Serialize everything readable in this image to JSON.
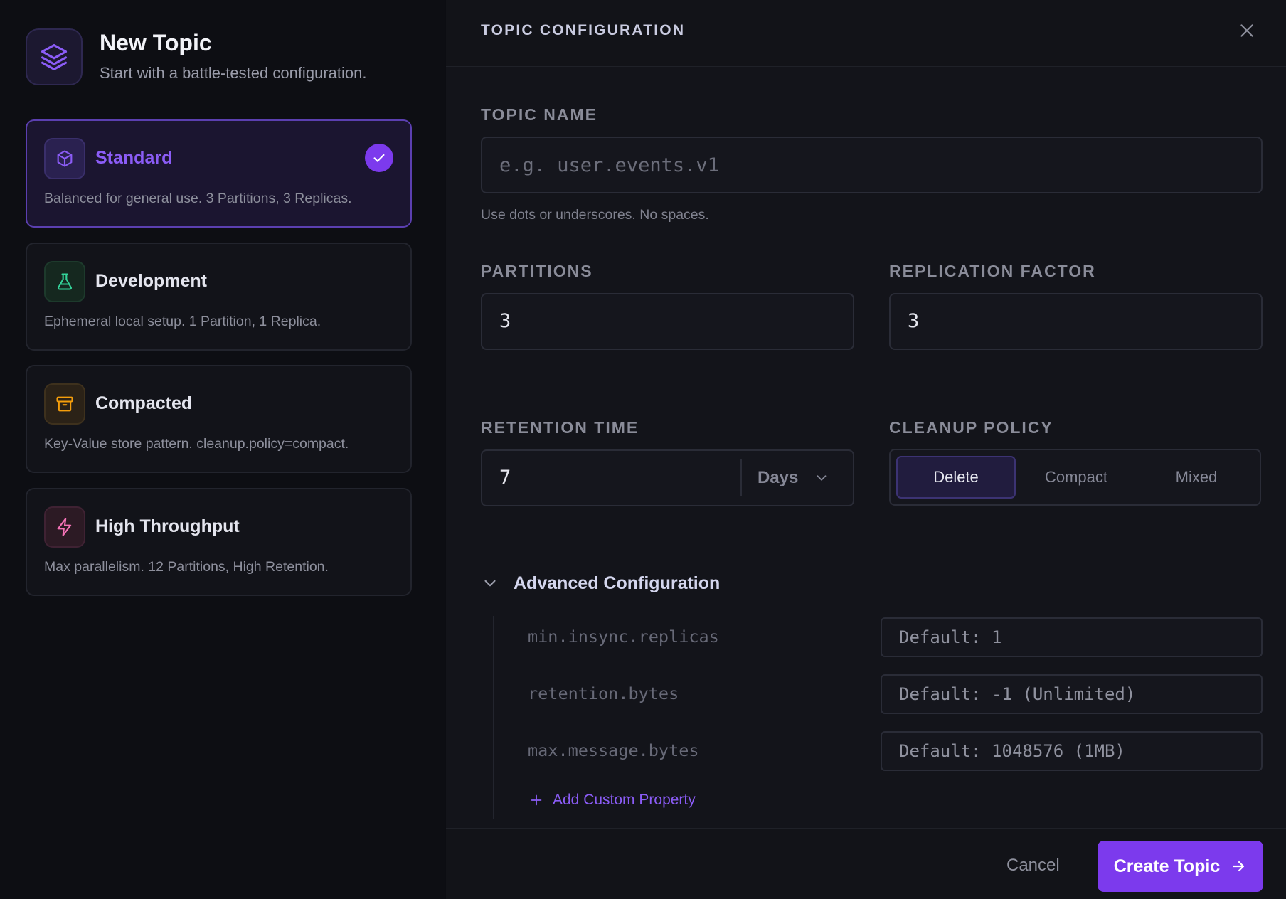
{
  "sidebar": {
    "title": "New Topic",
    "subtitle": "Start with a battle-tested configuration.",
    "presets": [
      {
        "name": "Standard",
        "description": "Balanced for general use. 3 Partitions, 3 Replicas.",
        "icon": "box-icon",
        "selected": true,
        "accent": "#8b5cf6"
      },
      {
        "name": "Development",
        "description": "Ephemeral local setup. 1 Partition, 1 Replica.",
        "icon": "flask-icon",
        "selected": false,
        "accent": "#34d399"
      },
      {
        "name": "Compacted",
        "description": "Key-Value store pattern. cleanup.policy=compact.",
        "icon": "archive-icon",
        "selected": false,
        "accent": "#f59e0b"
      },
      {
        "name": "High Throughput",
        "description": "Max parallelism. 12 Partitions, High Retention.",
        "icon": "lightning-icon",
        "selected": false,
        "accent": "#f472b6"
      }
    ]
  },
  "panel": {
    "title": "TOPIC CONFIGURATION",
    "topic_name": {
      "label": "TOPIC NAME",
      "placeholder": "e.g. user.events.v1",
      "value": "",
      "hint": "Use dots or underscores. No spaces."
    },
    "partitions": {
      "label": "PARTITIONS",
      "value": "3"
    },
    "replication": {
      "label": "REPLICATION FACTOR",
      "value": "3"
    },
    "retention": {
      "label": "RETENTION TIME",
      "value": "7",
      "unit": "Days"
    },
    "cleanup": {
      "label": "CLEANUP POLICY",
      "options": [
        "Delete",
        "Compact",
        "Mixed"
      ],
      "selected": "Delete"
    },
    "advanced": {
      "title": "Advanced Configuration",
      "expanded": true,
      "properties": [
        {
          "key": "min.insync.replicas",
          "placeholder": "Default: 1"
        },
        {
          "key": "retention.bytes",
          "placeholder": "Default: -1 (Unlimited)"
        },
        {
          "key": "max.message.bytes",
          "placeholder": "Default: 1048576 (1MB)"
        }
      ],
      "add_label": "Add Custom Property"
    }
  },
  "footer": {
    "cancel_label": "Cancel",
    "create_label": "Create Topic"
  },
  "colors": {
    "accent": "#7c3aed",
    "accent_light": "#8b5cf6",
    "background": "#0d0e13",
    "panel": "#13141a"
  }
}
